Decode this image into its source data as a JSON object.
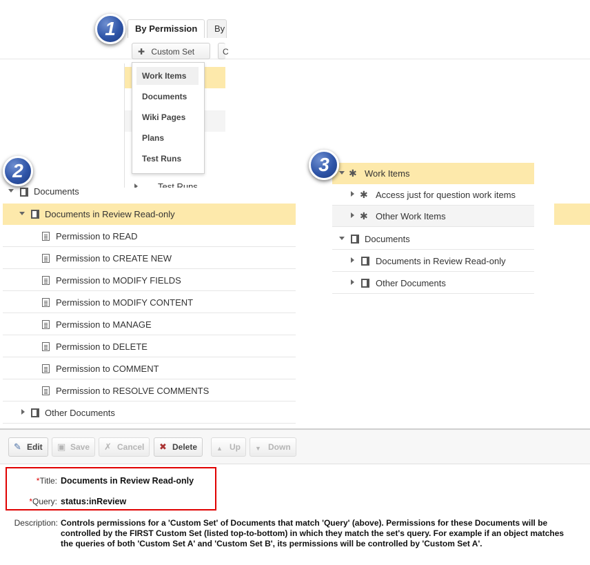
{
  "callouts": [
    "1",
    "2",
    "3"
  ],
  "panel1": {
    "tabs": [
      "By Permission",
      "By"
    ],
    "custom_set_button": "Custom Set",
    "add_icon": "plus-icon",
    "dropdown_icon": "caret-down-icon",
    "menu_items": [
      "Work Items",
      "Documents",
      "Wiki Pages",
      "Plans",
      "Test Runs"
    ],
    "partial_row_label": "Test Runs"
  },
  "panel2": {
    "root": "Documents",
    "selected": "Documents in Review Read-only",
    "permissions": [
      "Permission to READ",
      "Permission to CREATE NEW",
      "Permission to MODIFY FIELDS",
      "Permission to MODIFY CONTENT",
      "Permission to MANAGE",
      "Permission to DELETE",
      "Permission to COMMENT",
      "Permission to RESOLVE COMMENTS"
    ],
    "other": "Other Documents"
  },
  "panel3": {
    "rows": [
      "Work Items",
      "Access just for question work items",
      "Other Work Items",
      "Documents",
      "Documents in Review Read-only",
      "Other Documents"
    ]
  },
  "toolbar": {
    "edit": "Edit",
    "save": "Save",
    "cancel": "Cancel",
    "delete": "Delete",
    "up": "Up",
    "down": "Down"
  },
  "form": {
    "title_label": "Title:",
    "title_value": "Documents in Review Read-only",
    "query_label": "Query:",
    "query_value": "status:inReview",
    "required_marker": "*",
    "description_label": "Description:",
    "description_value": "Controls permissions for a 'Custom Set' of Documents that match 'Query' (above). Permissions for these Documents will be controlled by the FIRST Custom Set (listed top-to-bottom) in which they match the set's query. For example if an object matches the queries of both 'Custom Set A' and 'Custom Set B', its permissions will be controlled by 'Custom Set A'."
  },
  "colors": {
    "selected_row": "#fde9ab",
    "required": "#dd0000",
    "highlight_box": "#e00000",
    "callout": "#2f55a8"
  }
}
